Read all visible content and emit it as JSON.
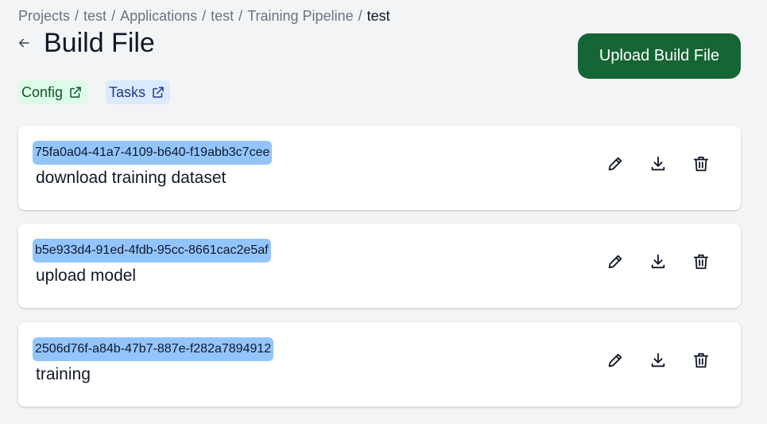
{
  "breadcrumb": [
    {
      "label": "Projects"
    },
    {
      "label": "test"
    },
    {
      "label": "Applications"
    },
    {
      "label": "test"
    },
    {
      "label": "Training Pipeline"
    },
    {
      "label": "test"
    }
  ],
  "breadcrumb_separator": "/",
  "page": {
    "title": "Build File",
    "back_icon": "arrow-left-icon"
  },
  "actions": {
    "upload_label": "Upload Build File",
    "upload_color": "#166534"
  },
  "links": {
    "config_label": "Config",
    "tasks_label": "Tasks",
    "link_icon": "external-link-icon"
  },
  "build_files": [
    {
      "id": "75fa0a04-41a7-4109-b640-f19abb3c7cee",
      "name": "download training dataset"
    },
    {
      "id": "b5e933d4-91ed-4fdb-95cc-8661cac2e5af",
      "name": "upload model"
    },
    {
      "id": "2506d76f-a84b-47b7-887e-f282a7894912",
      "name": "training"
    }
  ],
  "row_icons": [
    "pencil-icon",
    "download-icon",
    "trash-icon"
  ],
  "colors": {
    "id_highlight": "#93c5fd",
    "config_bg": "#dcfce7",
    "tasks_bg": "#dbeafe"
  }
}
